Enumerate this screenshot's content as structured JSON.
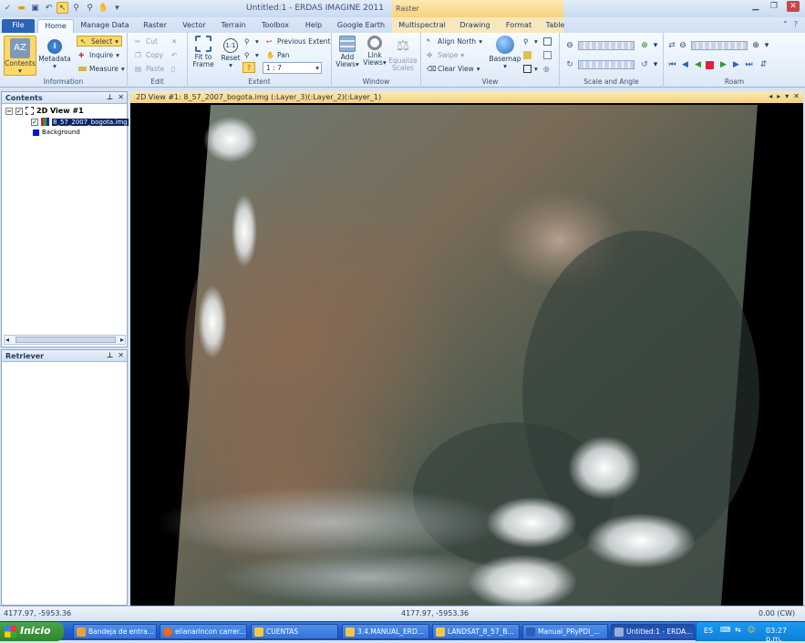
{
  "window": {
    "title": "Untitled:1 - ERDAS IMAGINE 2011",
    "context_tab": "Raster"
  },
  "qat": {
    "icons": [
      "erdas-logo",
      "open",
      "save",
      "undo",
      "select-pointer",
      "zoom",
      "zoom-out",
      "pan"
    ]
  },
  "tabs": {
    "file": "File",
    "home": "Home",
    "manage_data": "Manage Data",
    "raster": "Raster",
    "vector": "Vector",
    "terrain": "Terrain",
    "toolbox": "Toolbox",
    "help": "Help",
    "google_earth": "Google Earth",
    "multispectral": "Multispectral",
    "drawing": "Drawing",
    "format": "Format",
    "table": "Table"
  },
  "ribbon": {
    "information": {
      "label": "Information",
      "contents": "Contents",
      "metadata": "Metadata",
      "select": "Select",
      "inquire": "Inquire",
      "measure": "Measure"
    },
    "edit": {
      "label": "Edit",
      "cut": "Cut",
      "copy": "Copy",
      "paste": "Paste"
    },
    "extent": {
      "label": "Extent",
      "fit_to_frame_1": "Fit to",
      "fit_to_frame_2": "Frame",
      "reset": "Reset",
      "previous_extent": "Previous Extent",
      "pan": "Pan",
      "scale": "1 : 7"
    },
    "window": {
      "label": "Window",
      "add_views_1": "Add",
      "add_views_2": "Views",
      "link_views_1": "Link",
      "link_views_2": "Views",
      "equalize_1": "Equalize",
      "equalize_2": "Scales"
    },
    "view": {
      "label": "View",
      "align_north": "Align North",
      "swipe": "Swipe",
      "clear_view": "Clear View",
      "basemap": "Basemap"
    },
    "scale_angle": {
      "label": "Scale and Angle"
    },
    "roam": {
      "label": "Roam"
    }
  },
  "contents_pane": {
    "title": "Contents",
    "view_node": "2D View #1",
    "layer_node": "8_57_2007_bogota.img",
    "background_node": "Background"
  },
  "retriever_pane": {
    "title": "Retriever"
  },
  "view": {
    "header": "2D View #1: 8_57_2007_bogota.img (:Layer_3)(:Layer_2)(:Layer_1)"
  },
  "status": {
    "coords_left": "4177.97, -5953.36",
    "coords_mid": "4177.97, -5953.36",
    "rotation": "0.00 (CW)"
  },
  "taskbar": {
    "start": "Inicio",
    "items": [
      "Bandeja de entra...",
      "elianarincon carrer...",
      "CUENTAS",
      "3.4.MANUAL_ERD...",
      "LANDSAT_8_57_B...",
      "Manual_PRyPDI_...",
      "Untitled:1 - ERDA..."
    ],
    "language": "ES",
    "clock": "03:27 p.m."
  }
}
